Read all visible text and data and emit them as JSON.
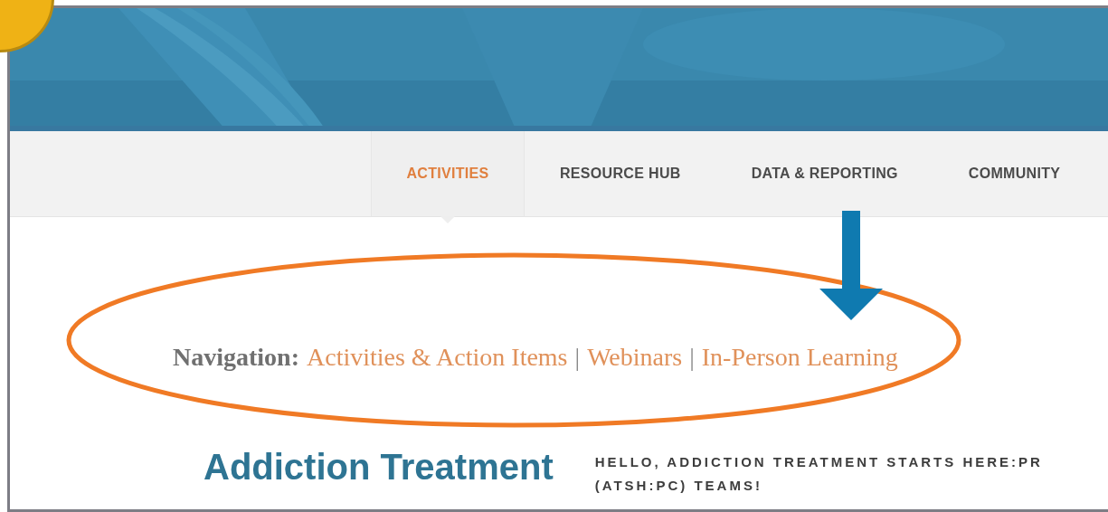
{
  "main_nav": [
    {
      "label": "ACTIVITIES",
      "selected": true
    },
    {
      "label": "RESOURCE HUB",
      "selected": false
    },
    {
      "label": "DATA & REPORTING",
      "selected": false
    },
    {
      "label": "COMMUNITY",
      "selected": false
    }
  ],
  "breadcrumb": {
    "label": "Navigation:",
    "separator": "|",
    "links": [
      "Activities & Action Items",
      "Webinars",
      "In-Person Learning"
    ]
  },
  "page_title": "Addiction Treatment",
  "intro_lines": [
    "HELLO, ADDICTION TREATMENT STARTS HERE:PR",
    "(ATSH:PC) TEAMS!"
  ]
}
